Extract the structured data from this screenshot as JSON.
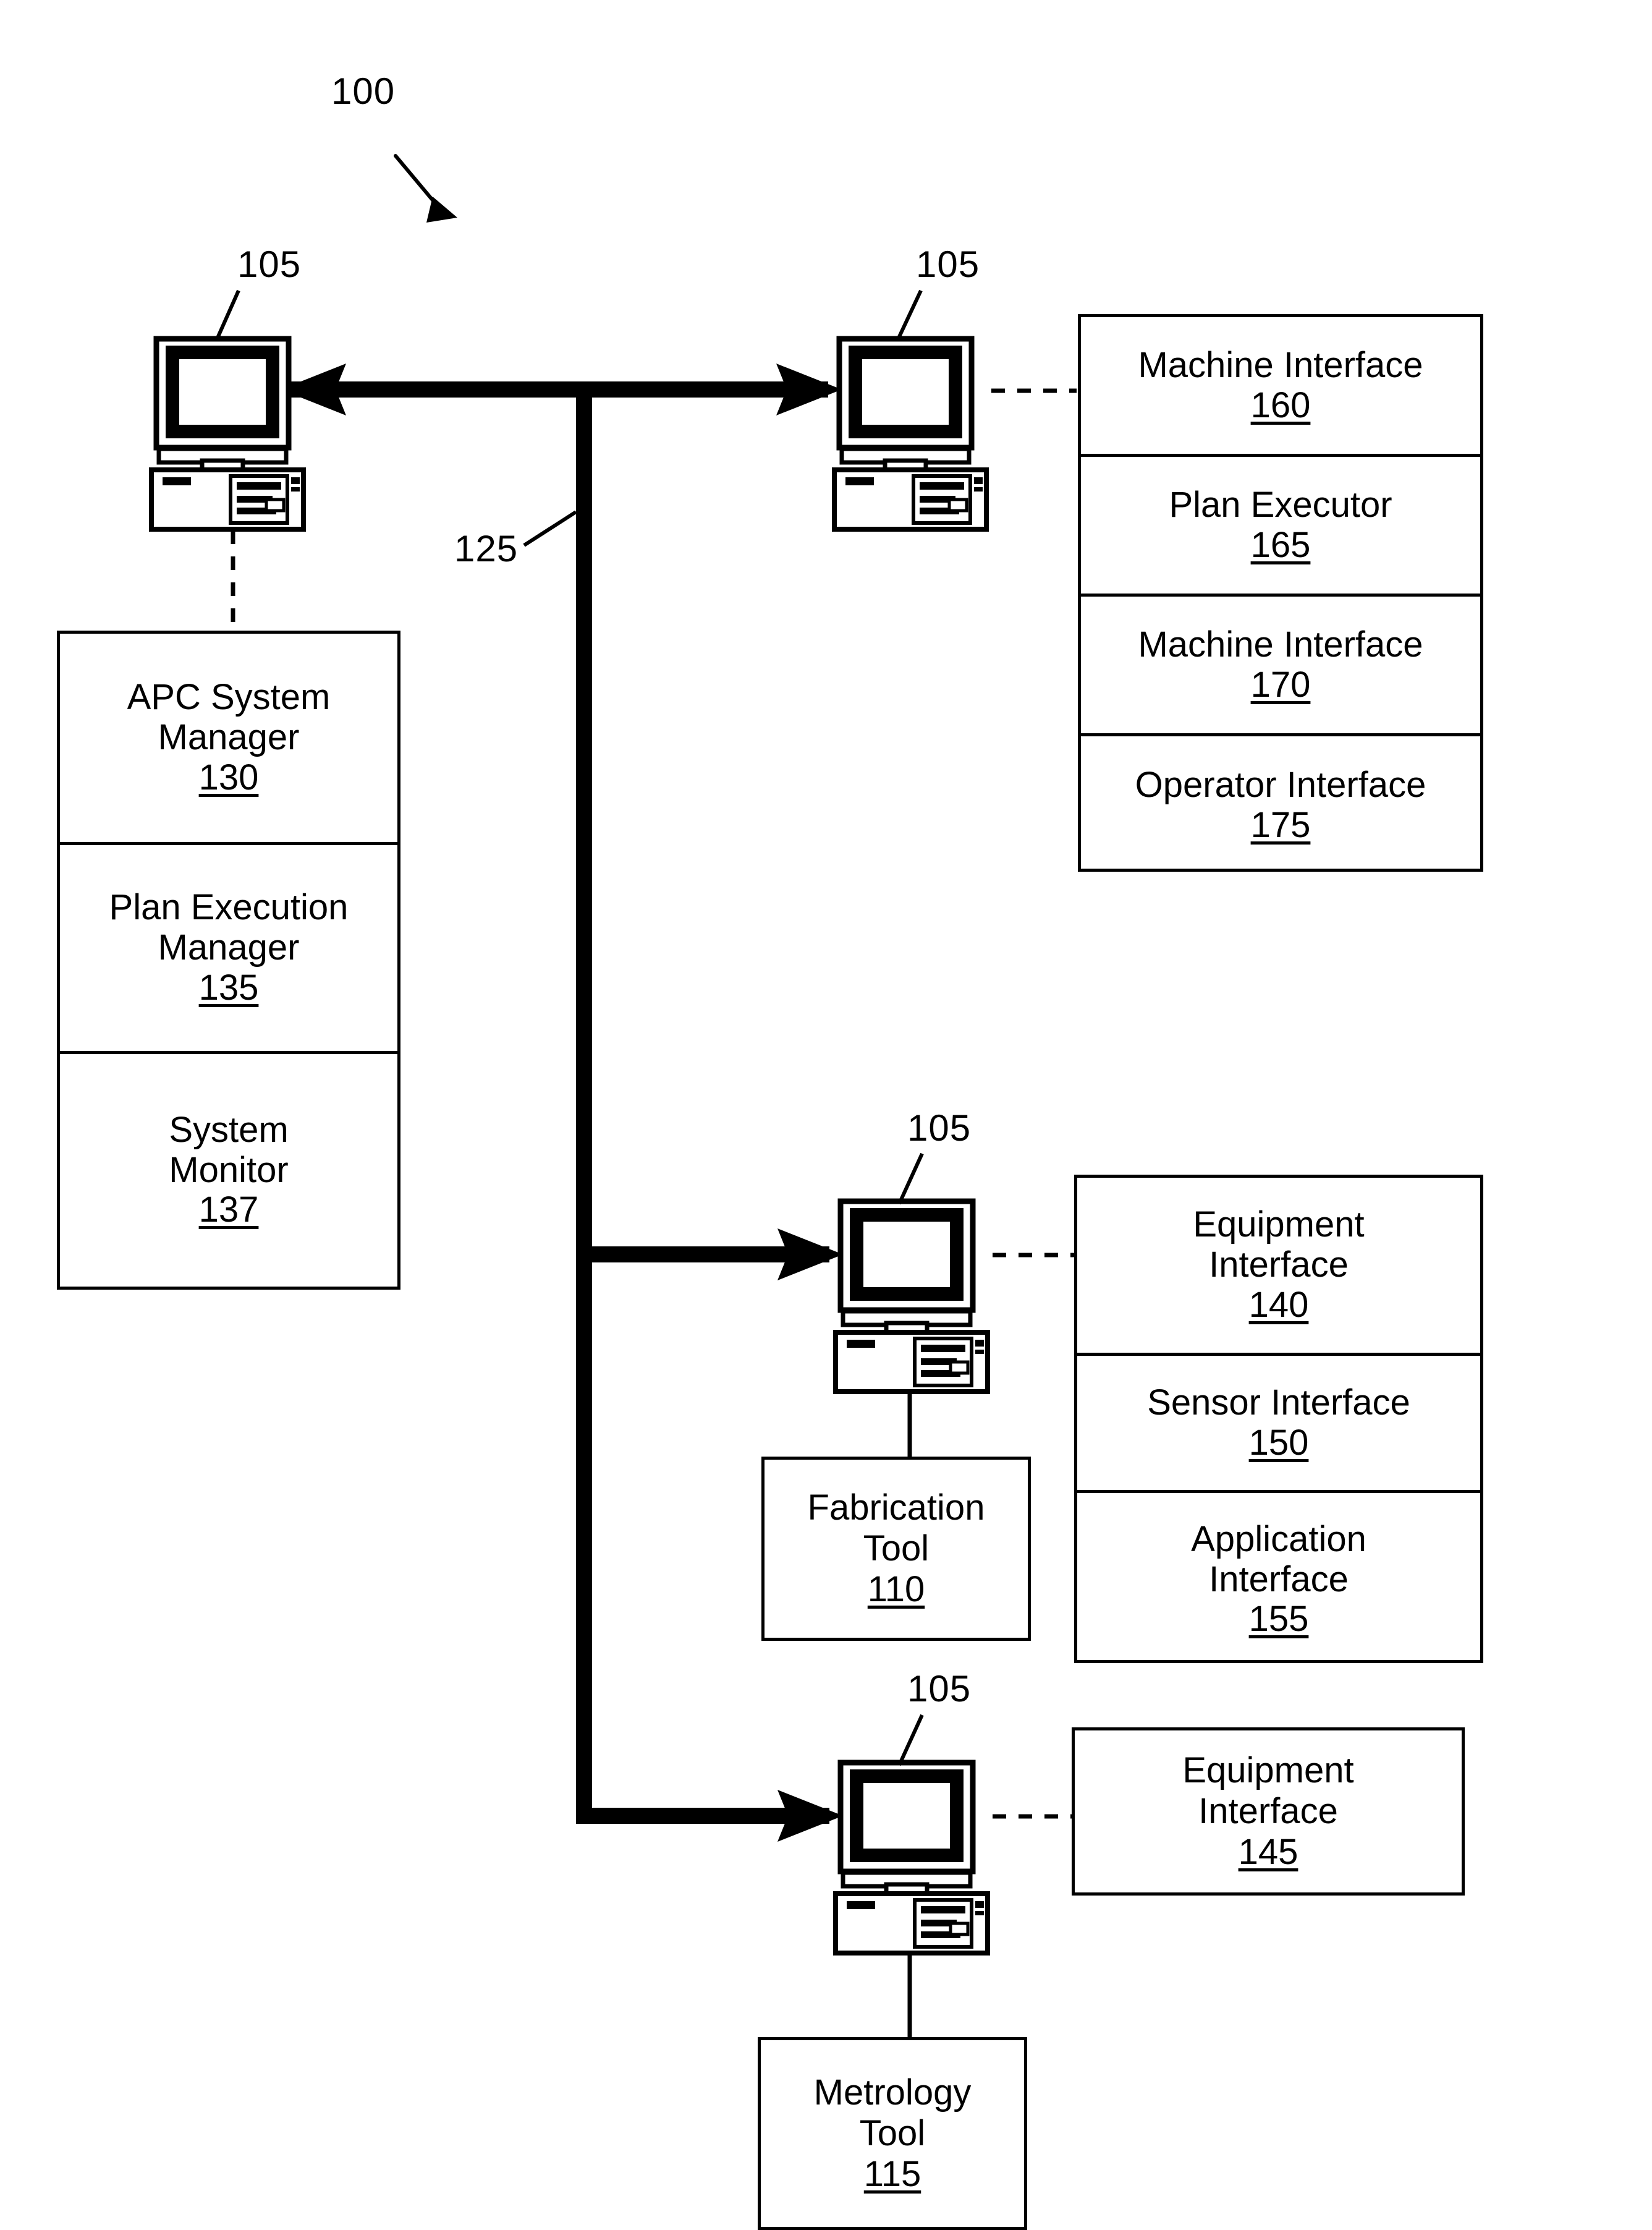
{
  "figure": {
    "system_ref": "100",
    "bus_ref": "125",
    "computer_refs": [
      "105",
      "105",
      "105",
      "105"
    ]
  },
  "icons": {
    "computer": "computer-workstation-icon",
    "leader": "leader-line-icon",
    "bus": "network-bus-icon",
    "arrow": "arrowhead-icon",
    "dashed": "dashed-connector-icon"
  },
  "apc_stack": {
    "name": "apc-system-stack",
    "cells": [
      {
        "title": "APC System\nManager",
        "ref": "130"
      },
      {
        "title": "Plan Execution\nManager",
        "ref": "135"
      },
      {
        "title": "System\nMonitor",
        "ref": "137"
      }
    ]
  },
  "machine_stack": {
    "name": "machine-interface-stack",
    "cells": [
      {
        "title": "Machine Interface",
        "ref": "160"
      },
      {
        "title": "Plan Executor",
        "ref": "165"
      },
      {
        "title": "Machine Interface",
        "ref": "170"
      },
      {
        "title": "Operator Interface",
        "ref": "175"
      }
    ]
  },
  "equipment_stack": {
    "name": "equipment-interface-stack",
    "cells": [
      {
        "title": "Equipment\nInterface",
        "ref": "140"
      },
      {
        "title": "Sensor Interface",
        "ref": "150"
      },
      {
        "title": "Application\nInterface",
        "ref": "155"
      }
    ]
  },
  "equipment_solo": {
    "name": "equipment-interface-145",
    "title": "Equipment\nInterface",
    "ref": "145"
  },
  "fabrication_tool": {
    "name": "fabrication-tool-110",
    "title": "Fabrication\nTool",
    "ref": "110"
  },
  "metrology_tool": {
    "name": "metrology-tool-115",
    "title": "Metrology\nTool",
    "ref": "115"
  }
}
